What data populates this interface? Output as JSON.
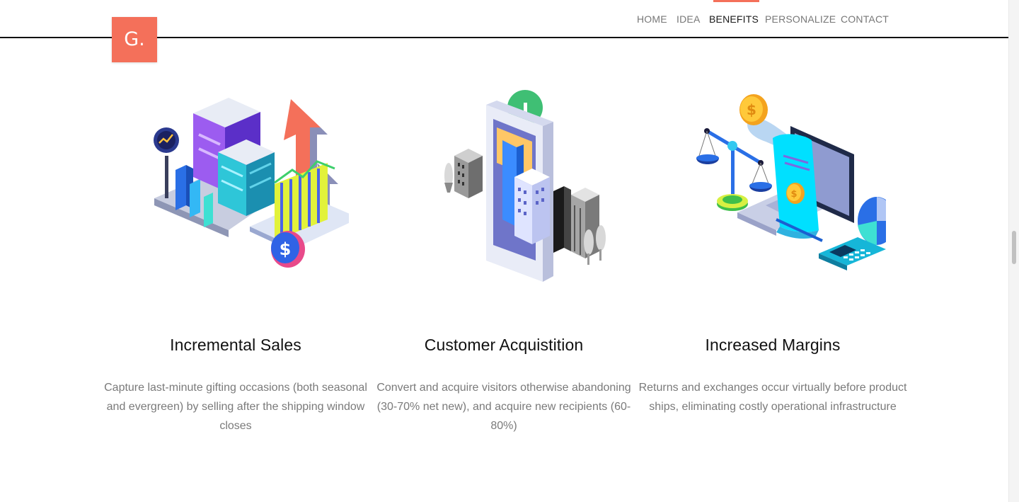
{
  "brand": {
    "logo_text": "G.",
    "accent": "#f4705a"
  },
  "nav": {
    "items": [
      {
        "label": "HOME"
      },
      {
        "label": "IDEA"
      },
      {
        "label": "BENEFITS",
        "active": true
      },
      {
        "label": "PERSONALIZE"
      },
      {
        "label": "CONTACT"
      }
    ]
  },
  "features": [
    {
      "title": "Incremental Sales",
      "description": "Capture last-minute gifting occasions (both seasonal and evergreen) by selling after the shipping window closes",
      "icon": "isometric-sales-growth-icon"
    },
    {
      "title": "Customer Acquistition",
      "description": "Convert and acquire visitors otherwise abandoning (30-70% net new), and acquire new recipients (60-80%)",
      "icon": "isometric-phone-city-icon"
    },
    {
      "title": "Increased Margins",
      "description": "Returns and exchanges occur virtually before product ships, eliminating costly operational infrastructure",
      "icon": "isometric-laptop-scale-icon"
    }
  ]
}
